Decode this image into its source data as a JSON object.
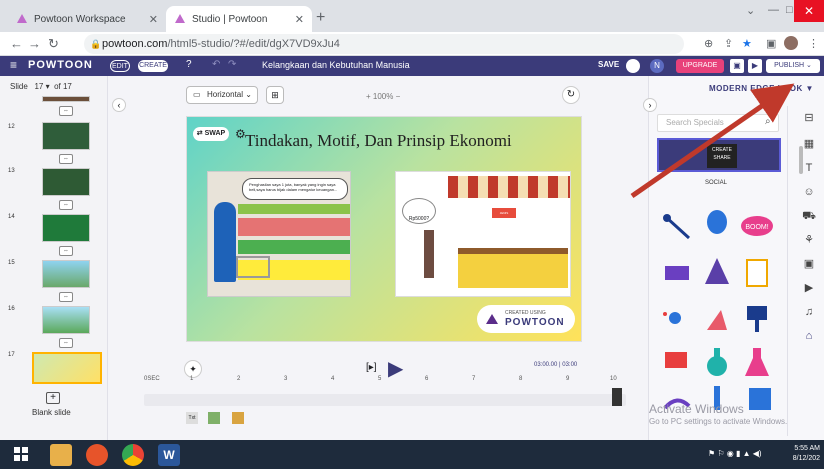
{
  "browser": {
    "tabs": [
      {
        "label": "Powtoon Workspace"
      },
      {
        "label": "Studio | Powtoon"
      }
    ],
    "url_host": "powtoon.com",
    "url_path": "/html5-studio/?#/edit/dgX7VD9xJu4"
  },
  "header": {
    "logo": "POWTOON",
    "edit_label": "EDIT",
    "create_label": "CREATE",
    "project_title": "Kelangkaan dan Kebutuhan Manusia",
    "save_label": "SAVE",
    "avatar_letter": "N",
    "upgrade_label": "UPGRADE",
    "publish_label": "PUBLISH"
  },
  "slides_panel": {
    "slide_label": "Slide",
    "current": "17",
    "total_label": "of 17",
    "slide_numbers": [
      "12",
      "13",
      "14",
      "15",
      "16",
      "17"
    ],
    "blank_slide_label": "Blank slide"
  },
  "editor": {
    "orientation_label": "Horizontal",
    "zoom_label": "100%",
    "canvas_title": "Tindakan, Motif, Dan Prinsip Ekonomi",
    "swap_label": "SWAP",
    "speech_bubble": "Penghasilan saya 1 juta, banyak yang ingin saya beli,saya harus bijak dalam mengatur keuangan...",
    "price_tag": "Rp5000?",
    "stall_sign": "JENIS MAKANAN",
    "created_using_label": "CREATED USING",
    "created_using_brand": "POWTOON",
    "time_display": "03:00.00 | 03:00",
    "timeline_start": "0SEC",
    "timeline_ticks": [
      "1",
      "2",
      "3",
      "4",
      "5",
      "6",
      "7",
      "8",
      "9",
      "10"
    ]
  },
  "right_panel": {
    "style_title": "MODERN EDGE LOOK",
    "search_placeholder": "Search Specials",
    "category_label": "SOCIAL",
    "tile_create": "CREATE",
    "tile_share": "SHARE",
    "boom_label": "BOOM!"
  },
  "watermark": {
    "line1": "Activate Windows",
    "line2": "Go to PC settings to activate Windows."
  },
  "taskbar": {
    "time": "5:55 AM",
    "date": "8/12/202"
  },
  "colors": {
    "header": "#3b3b7a",
    "upgrade": "#e8417a",
    "accent_arrow": "#c0392b"
  }
}
